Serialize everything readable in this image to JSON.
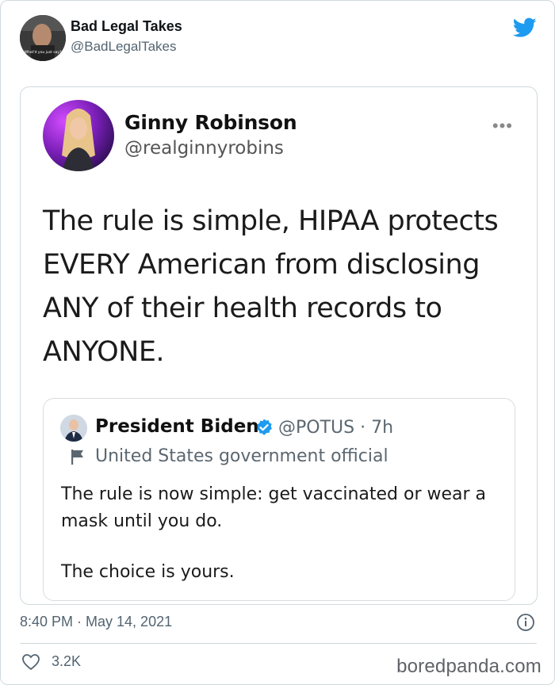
{
  "author": {
    "name": "Bad Legal Takes",
    "handle": "@BadLegalTakes",
    "avatar_caption": "What'd you just say?"
  },
  "embedded_tweet": {
    "name": "Ginny Robinson",
    "handle": "@realginnyrobins",
    "more": "•••",
    "lines": [
      "The rule is simple, HIPAA protects",
      "EVERY American from disclosing",
      "ANY of their health records to",
      "ANYONE."
    ],
    "quote": {
      "name": "President Biden",
      "handle": "@POTUS · 7h",
      "label": "United States government official",
      "text": "The rule is now simple: get vaccinated or wear a mask until you do.",
      "text2": "The choice is yours."
    }
  },
  "footer": {
    "timestamp": "8:40 PM · May 14, 2021",
    "likes": "3.2K",
    "watermark": "boredpanda.com"
  },
  "colors": {
    "twitter_blue": "#1d9bf0",
    "muted": "#536471",
    "border": "#cfd9de"
  }
}
